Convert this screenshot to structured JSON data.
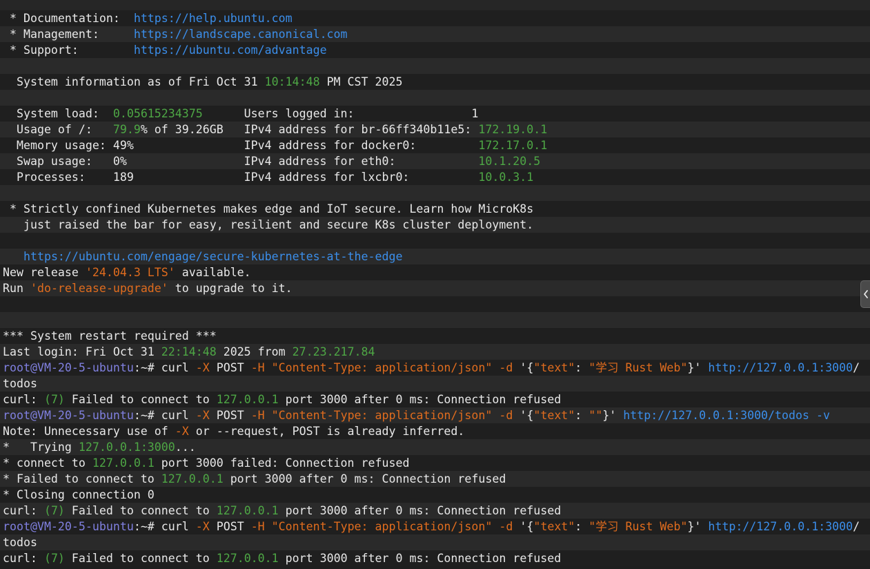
{
  "terminal": {
    "lines": [
      [
        {
          "t": " * Documentation:  ",
          "c": "white"
        },
        {
          "t": "https://help.ubuntu.com",
          "c": "link"
        }
      ],
      [
        {
          "t": " * Management:     ",
          "c": "white"
        },
        {
          "t": "https://landscape.canonical.com",
          "c": "link"
        }
      ],
      [
        {
          "t": " * Support:        ",
          "c": "white"
        },
        {
          "t": "https://ubuntu.com/advantage",
          "c": "link"
        }
      ],
      [],
      [
        {
          "t": "  System information as of Fri Oct 31 ",
          "c": "white"
        },
        {
          "t": "10:14:48",
          "c": "green"
        },
        {
          "t": " PM CST 2025",
          "c": "white"
        }
      ],
      [],
      [
        {
          "t": "  System load:  ",
          "c": "white"
        },
        {
          "t": "0.05615234375",
          "c": "green"
        },
        {
          "t": "      Users logged in:                 1",
          "c": "white"
        }
      ],
      [
        {
          "t": "  Usage of /:   ",
          "c": "white"
        },
        {
          "t": "79.9",
          "c": "green"
        },
        {
          "t": "% of 39.26GB   IPv4 address for br-66ff340b11e5: ",
          "c": "white"
        },
        {
          "t": "172.19.0.1",
          "c": "green"
        }
      ],
      [
        {
          "t": "  Memory usage: 49%                IPv4 address for docker0:         ",
          "c": "white"
        },
        {
          "t": "172.17.0.1",
          "c": "green"
        }
      ],
      [
        {
          "t": "  Swap usage:   0%                 IPv4 address for eth0:            ",
          "c": "white"
        },
        {
          "t": "10.1.20.5",
          "c": "green"
        }
      ],
      [
        {
          "t": "  Processes:    189                IPv4 address for lxcbr0:          ",
          "c": "white"
        },
        {
          "t": "10.0.3.1",
          "c": "green"
        }
      ],
      [],
      [
        {
          "t": " * Strictly confined Kubernetes makes edge and IoT secure. Learn how MicroK8s",
          "c": "white"
        }
      ],
      [
        {
          "t": "   just raised the bar for easy, resilient and secure K8s cluster deployment.",
          "c": "white"
        }
      ],
      [],
      [
        {
          "t": "   ",
          "c": "white"
        },
        {
          "t": "https://ubuntu.com/engage/secure-kubernetes-at-the-edge",
          "c": "link"
        }
      ],
      [
        {
          "t": "New release ",
          "c": "white"
        },
        {
          "t": "'24.04.3 LTS'",
          "c": "orange"
        },
        {
          "t": " available.",
          "c": "white"
        }
      ],
      [
        {
          "t": "Run ",
          "c": "white"
        },
        {
          "t": "'do-release-upgrade'",
          "c": "orange"
        },
        {
          "t": " to upgrade to it.",
          "c": "white"
        }
      ],
      [],
      [],
      [
        {
          "t": "*** System restart required ***",
          "c": "white"
        }
      ],
      [
        {
          "t": "Last login: Fri Oct 31 ",
          "c": "white"
        },
        {
          "t": "22:14:48",
          "c": "green"
        },
        {
          "t": " 2025 from ",
          "c": "white"
        },
        {
          "t": "27.23.217.84",
          "c": "green"
        }
      ],
      [
        {
          "t": "root@VM-20-5-ubuntu",
          "c": "prompt"
        },
        {
          "t": ":~# curl ",
          "c": "white"
        },
        {
          "t": "-X",
          "c": "orange"
        },
        {
          "t": " POST ",
          "c": "white"
        },
        {
          "t": "-H",
          "c": "orange"
        },
        {
          "t": " ",
          "c": "white"
        },
        {
          "t": "\"Content-Type: application/json\"",
          "c": "orange"
        },
        {
          "t": " ",
          "c": "white"
        },
        {
          "t": "-d",
          "c": "orange"
        },
        {
          "t": " '{",
          "c": "white"
        },
        {
          "t": "\"text\"",
          "c": "orange"
        },
        {
          "t": ": ",
          "c": "white"
        },
        {
          "t": "\"学习 Rust Web\"",
          "c": "orange"
        },
        {
          "t": "}' ",
          "c": "white"
        },
        {
          "t": "http://127.0.0.1:3000",
          "c": "link"
        },
        {
          "t": "/",
          "c": "white"
        }
      ],
      [
        {
          "t": "todos",
          "c": "white"
        }
      ],
      [
        {
          "t": "curl: ",
          "c": "white"
        },
        {
          "t": "(7)",
          "c": "green"
        },
        {
          "t": " Failed to connect to ",
          "c": "white"
        },
        {
          "t": "127.0.0.1",
          "c": "green"
        },
        {
          "t": " port 3000 after 0 ms: Connection refused",
          "c": "white"
        }
      ],
      [
        {
          "t": "root@VM-20-5-ubuntu",
          "c": "prompt"
        },
        {
          "t": ":~# curl ",
          "c": "white"
        },
        {
          "t": "-X",
          "c": "orange"
        },
        {
          "t": " POST ",
          "c": "white"
        },
        {
          "t": "-H",
          "c": "orange"
        },
        {
          "t": " ",
          "c": "white"
        },
        {
          "t": "\"Content-Type: application/json\"",
          "c": "orange"
        },
        {
          "t": " ",
          "c": "white"
        },
        {
          "t": "-d",
          "c": "orange"
        },
        {
          "t": " '{",
          "c": "white"
        },
        {
          "t": "\"text\"",
          "c": "orange"
        },
        {
          "t": ": ",
          "c": "white"
        },
        {
          "t": "\"\"",
          "c": "orange"
        },
        {
          "t": "}' ",
          "c": "white"
        },
        {
          "t": "http://127.0.0.1:3000/todos",
          "c": "link"
        },
        {
          "t": " ",
          "c": "white"
        },
        {
          "t": "-v",
          "c": "link"
        }
      ],
      [
        {
          "t": "Note: Unnecessary use of ",
          "c": "white"
        },
        {
          "t": "-X",
          "c": "orange"
        },
        {
          "t": " or --request, POST is already inferred.",
          "c": "white"
        }
      ],
      [
        {
          "t": "*   Trying ",
          "c": "white"
        },
        {
          "t": "127.0.0.1:3000",
          "c": "green"
        },
        {
          "t": "...",
          "c": "white"
        }
      ],
      [
        {
          "t": "* connect to ",
          "c": "white"
        },
        {
          "t": "127.0.0.1",
          "c": "green"
        },
        {
          "t": " port 3000 failed: Connection refused",
          "c": "white"
        }
      ],
      [
        {
          "t": "* Failed to connect to ",
          "c": "white"
        },
        {
          "t": "127.0.0.1",
          "c": "green"
        },
        {
          "t": " port 3000 after 0 ms: Connection refused",
          "c": "white"
        }
      ],
      [
        {
          "t": "* Closing connection 0",
          "c": "white"
        }
      ],
      [
        {
          "t": "curl: ",
          "c": "white"
        },
        {
          "t": "(7)",
          "c": "green"
        },
        {
          "t": " Failed to connect to ",
          "c": "white"
        },
        {
          "t": "127.0.0.1",
          "c": "green"
        },
        {
          "t": " port 3000 after 0 ms: Connection refused",
          "c": "white"
        }
      ],
      [
        {
          "t": "root@VM-20-5-ubuntu",
          "c": "prompt"
        },
        {
          "t": ":~# curl ",
          "c": "white"
        },
        {
          "t": "-X",
          "c": "orange"
        },
        {
          "t": " POST ",
          "c": "white"
        },
        {
          "t": "-H",
          "c": "orange"
        },
        {
          "t": " ",
          "c": "white"
        },
        {
          "t": "\"Content-Type: application/json\"",
          "c": "orange"
        },
        {
          "t": " ",
          "c": "white"
        },
        {
          "t": "-d",
          "c": "orange"
        },
        {
          "t": " '{",
          "c": "white"
        },
        {
          "t": "\"text\"",
          "c": "orange"
        },
        {
          "t": ": ",
          "c": "white"
        },
        {
          "t": "\"学习 Rust Web\"",
          "c": "orange"
        },
        {
          "t": "}' ",
          "c": "white"
        },
        {
          "t": "http://127.0.0.1:3000",
          "c": "link"
        },
        {
          "t": "/",
          "c": "white"
        }
      ],
      [
        {
          "t": "todos",
          "c": "white"
        }
      ],
      [
        {
          "t": "curl: ",
          "c": "white"
        },
        {
          "t": "(7)",
          "c": "green"
        },
        {
          "t": " Failed to connect to ",
          "c": "white"
        },
        {
          "t": "127.0.0.1",
          "c": "green"
        },
        {
          "t": " port 3000 after 0 ms: Connection refused",
          "c": "white"
        }
      ]
    ]
  },
  "side_handle": {
    "icon": "chevron-left-icon"
  },
  "colors": {
    "background": "#1e1e1e",
    "text": "#e8e8e8",
    "link": "#3b8eea",
    "green": "#4ea745",
    "orange": "#e06c1e",
    "prompt": "#8080e0"
  }
}
